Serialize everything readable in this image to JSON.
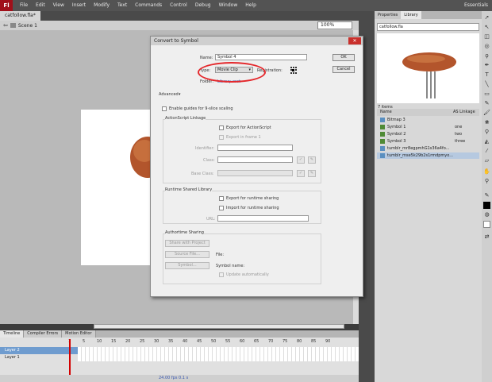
{
  "menu": {
    "logo": "Fl",
    "items": [
      "File",
      "Edit",
      "View",
      "Insert",
      "Modify",
      "Text",
      "Commands",
      "Control",
      "Debug",
      "Window",
      "Help"
    ],
    "workspace": "Essentials"
  },
  "document": {
    "tab": "catfollow.fla*",
    "scene": "Scene 1",
    "zoom": "100%"
  },
  "timeline": {
    "tabs": [
      "Timeline",
      "Compiler Errors",
      "Motion Editor"
    ],
    "layers": [
      "Layer 2",
      "Layer 1"
    ],
    "ruler": [
      "1",
      "5",
      "10",
      "15",
      "20",
      "25",
      "30",
      "35",
      "40",
      "45",
      "50",
      "55",
      "60",
      "65",
      "70",
      "75",
      "80",
      "85",
      "90"
    ],
    "footer": "24.00 fps  0.1 s"
  },
  "library": {
    "tabs": [
      "Properties",
      "Library"
    ],
    "file": "catfollow.fla",
    "count": "7 items",
    "col_name": "Name",
    "col_link": "AS Linkage",
    "items": [
      {
        "name": "Bitmap 3",
        "link": "",
        "type": "bitmap"
      },
      {
        "name": "Symbol 1",
        "link": "one",
        "type": "symbol"
      },
      {
        "name": "Symbol 2",
        "link": "two",
        "type": "symbol"
      },
      {
        "name": "Symbol 3",
        "link": "three",
        "type": "symbol"
      },
      {
        "name": "tumblr_mr8egpmhG1s36a4fo...",
        "link": "",
        "type": "bitmap"
      },
      {
        "name": "tumblr_mse5k29b2s1rmdpmyo...",
        "link": "",
        "type": "bitmap"
      }
    ]
  },
  "dialog": {
    "title": "Convert to Symbol",
    "name_label": "Name:",
    "name_value": "Symbol 4",
    "type_label": "Type:",
    "type_value": "Movie Clip",
    "registration_label": "Registration:",
    "folder_label": "Folder:",
    "folder_value": "Library root",
    "ok": "OK",
    "cancel": "Cancel",
    "advanced": "Advanced",
    "nine_slice": "Enable guides for 9-slice scaling",
    "as_title": "ActionScript Linkage",
    "export_as": "Export for ActionScript",
    "export_frame": "Export in frame 1",
    "identifier": "Identifier:",
    "class": "Class:",
    "base_class": "Base Class:",
    "rsl_title": "Runtime Shared Library",
    "export_runtime": "Export for runtime sharing",
    "import_runtime": "Import for runtime sharing",
    "url": "URL:",
    "auth_title": "Authortime Sharing",
    "share_project": "Share with Project",
    "source_file": "Source File...",
    "symbol_btn": "Symbol...",
    "file_label": "File:",
    "symbol_name": "Symbol name:",
    "update_auto": "Update automatically"
  },
  "colors": {
    "highlight": "#e4282c",
    "selection": "#6f9ccf"
  }
}
